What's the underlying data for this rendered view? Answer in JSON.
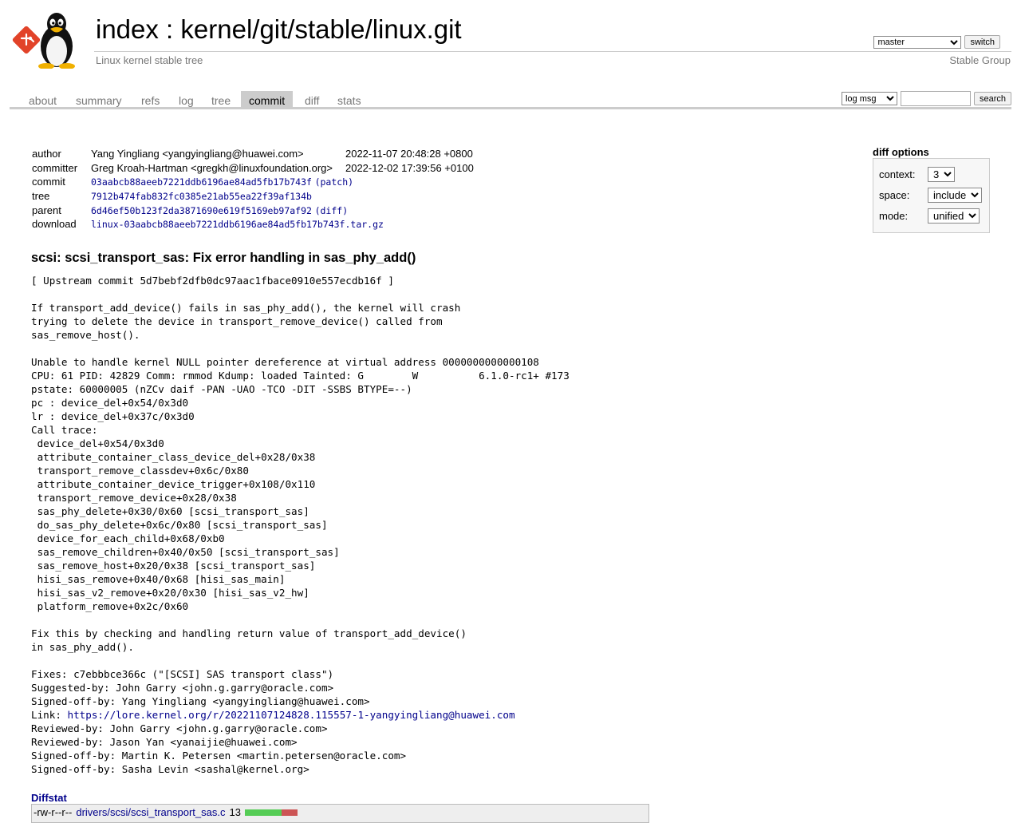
{
  "header": {
    "title_index": "index",
    "title_sep": " : ",
    "title_repo": "kernel/git/stable/linux.git",
    "subtitle": "Linux kernel stable tree",
    "owner": "Stable Group",
    "branch": "master",
    "switch_label": "switch"
  },
  "tabs": [
    {
      "label": "about"
    },
    {
      "label": "summary"
    },
    {
      "label": "refs"
    },
    {
      "label": "log"
    },
    {
      "label": "tree"
    },
    {
      "label": "commit"
    },
    {
      "label": "diff"
    },
    {
      "label": "stats"
    }
  ],
  "active_tab": "commit",
  "search": {
    "mode": "log msg",
    "query": "",
    "button": "search"
  },
  "commit_info": {
    "author_label": "author",
    "author": "Yang Yingliang <yangyingliang@huawei.com>",
    "author_date": "2022-11-07 20:48:28 +0800",
    "committer_label": "committer",
    "committer": "Greg Kroah-Hartman <gregkh@linuxfoundation.org>",
    "committer_date": "2022-12-02 17:39:56 +0100",
    "commit_label": "commit",
    "commit": "03aabcb88aeeb7221ddb6196ae84ad5fb17b743f",
    "patch_link": "(patch)",
    "tree_label": "tree",
    "tree": "7912b474fab832fc0385e21ab55ea22f39af134b",
    "parent_label": "parent",
    "parent": "6d46ef50b123f2da3871690e619f5169eb97af92",
    "diff_link": "(diff)",
    "download_label": "download",
    "download": "linux-03aabcb88aeeb7221ddb6196ae84ad5fb17b743f.tar.gz"
  },
  "diff_options": {
    "title": "diff options",
    "context_label": "context:",
    "context": "3",
    "space_label": "space:",
    "space": "include",
    "mode_label": "mode:",
    "mode": "unified"
  },
  "message": {
    "subject": "scsi: scsi_transport_sas: Fix error handling in sas_phy_add()",
    "body_before_link": "[ Upstream commit 5d7bebf2dfb0dc97aac1fbace0910e557ecdb16f ]\n\nIf transport_add_device() fails in sas_phy_add(), the kernel will crash\ntrying to delete the device in transport_remove_device() called from\nsas_remove_host().\n\nUnable to handle kernel NULL pointer dereference at virtual address 0000000000000108\nCPU: 61 PID: 42829 Comm: rmmod Kdump: loaded Tainted: G        W          6.1.0-rc1+ #173\npstate: 60000005 (nZCv daif -PAN -UAO -TCO -DIT -SSBS BTYPE=--)\npc : device_del+0x54/0x3d0\nlr : device_del+0x37c/0x3d0\nCall trace:\n device_del+0x54/0x3d0\n attribute_container_class_device_del+0x28/0x38\n transport_remove_classdev+0x6c/0x80\n attribute_container_device_trigger+0x108/0x110\n transport_remove_device+0x28/0x38\n sas_phy_delete+0x30/0x60 [scsi_transport_sas]\n do_sas_phy_delete+0x6c/0x80 [scsi_transport_sas]\n device_for_each_child+0x68/0xb0\n sas_remove_children+0x40/0x50 [scsi_transport_sas]\n sas_remove_host+0x20/0x38 [scsi_transport_sas]\n hisi_sas_remove+0x40/0x68 [hisi_sas_main]\n hisi_sas_v2_remove+0x20/0x30 [hisi_sas_v2_hw]\n platform_remove+0x2c/0x60\n\nFix this by checking and handling return value of transport_add_device()\nin sas_phy_add().\n\nFixes: c7ebbbce366c (\"[SCSI] SAS transport class\")\nSuggested-by: John Garry <john.g.garry@oracle.com>\nSigned-off-by: Yang Yingliang <yangyingliang@huawei.com>\n",
    "link_prefix": "Link: ",
    "link": "https://lore.kernel.org/r/20221107124828.115557-1-yangyingliang@huawei.com",
    "body_after_link": "\nReviewed-by: John Garry <john.g.garry@oracle.com>\nReviewed-by: Jason Yan <yanaijie@huawei.com>\nSigned-off-by: Martin K. Petersen <martin.petersen@oracle.com>\nSigned-off-by: Sasha Levin <sashal@kernel.org>"
  },
  "diffstat": {
    "header": "Diffstat",
    "rows": [
      {
        "mode": "-rw-r--r--",
        "file": "drivers/scsi/scsi_transport_sas.c",
        "changes": "13",
        "added_fraction": 0.69,
        "removed_fraction": 0.31
      }
    ]
  },
  "colors": {
    "link": "#00008b",
    "tab_active_bg": "#cccccc",
    "muted_text": "#777777",
    "diffstat_add": "#55cc55",
    "diffstat_del": "#cc5555"
  }
}
